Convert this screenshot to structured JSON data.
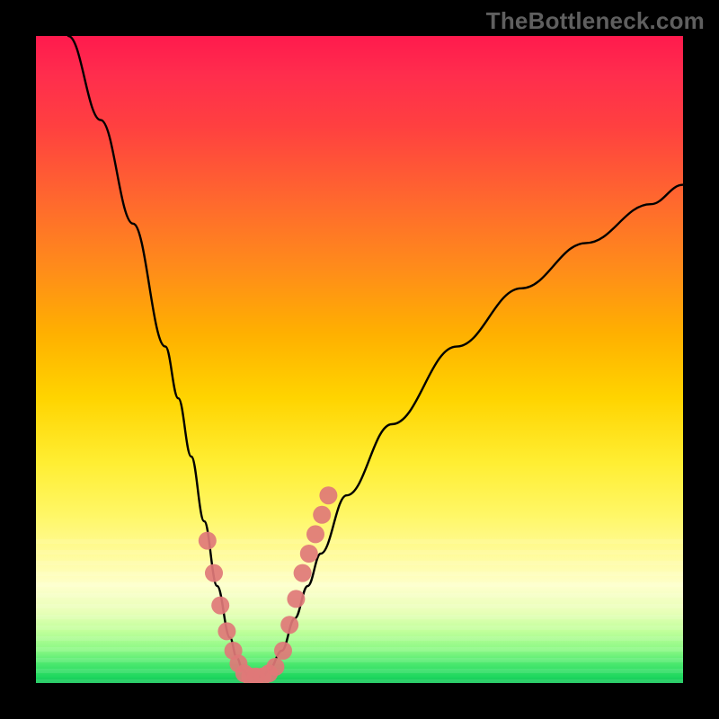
{
  "watermark": {
    "text": "TheBottleneck.com"
  },
  "colors": {
    "curve_stroke": "#000000",
    "dot_fill": "#e07878",
    "frame_bg": "#000000"
  },
  "chart_data": {
    "type": "line",
    "title": "",
    "xlabel": "",
    "ylabel": "",
    "xlim": [
      0,
      100
    ],
    "ylim": [
      0,
      100
    ],
    "grid": false,
    "series": [
      {
        "name": "bottleneck-curve",
        "x": [
          5,
          10,
          15,
          20,
          22,
          24,
          26,
          28,
          30,
          31,
          32,
          33,
          34,
          35,
          36,
          38,
          40,
          42,
          44,
          48,
          55,
          65,
          75,
          85,
          95,
          100
        ],
        "y": [
          100,
          87,
          71,
          52,
          44,
          35,
          25,
          15,
          7,
          4,
          2,
          1,
          1,
          1,
          2,
          5,
          10,
          15,
          20,
          29,
          40,
          52,
          61,
          68,
          74,
          77
        ]
      }
    ],
    "highlight_dots": {
      "name": "v-bottom-dots",
      "x": [
        26.5,
        27.5,
        28.5,
        29.5,
        30.5,
        31.3,
        32.2,
        33.1,
        34.0,
        35.0,
        36.0,
        37.0,
        38.2,
        39.2,
        40.2,
        41.2,
        42.2,
        43.2,
        44.2,
        45.2
      ],
      "y": [
        22,
        17,
        12,
        8,
        5,
        3,
        1.5,
        1,
        1,
        1,
        1.5,
        2.5,
        5,
        9,
        13,
        17,
        20,
        23,
        26,
        29
      ]
    }
  }
}
